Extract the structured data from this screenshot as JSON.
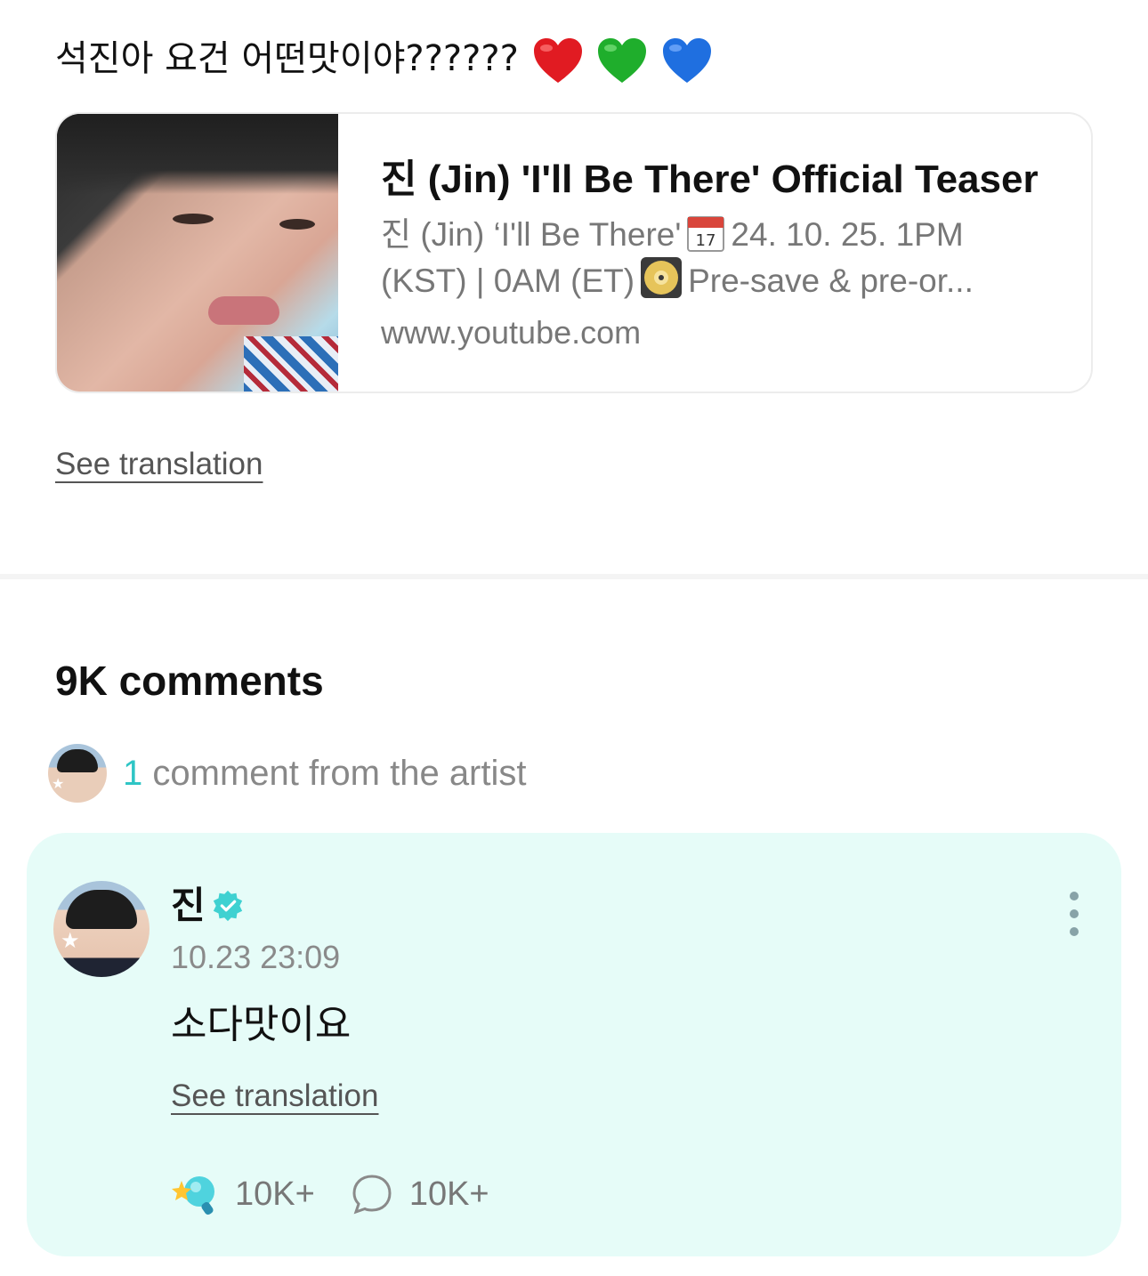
{
  "post": {
    "text": "석진아 요건 어떤맛이야??????",
    "emojis": [
      "red-heart",
      "green-heart",
      "blue-heart"
    ],
    "see_translation": "See translation"
  },
  "link_card": {
    "title": "진 (Jin) 'I'll Be There' Official Teaser",
    "description_part1": "진 (Jin) ‘I'll Be There'",
    "description_part2": "24. 10. 25. 1PM (KST) | 0AM (ET)",
    "description_part3": "Pre-save & pre-or...",
    "url": "www.youtube.com"
  },
  "comments": {
    "title": "9K comments",
    "artist_count": "1",
    "artist_label": "comment from the artist"
  },
  "comment": {
    "author": "진",
    "time": "10.23 23:09",
    "body": "소다맛이요",
    "see_translation": "See translation",
    "likes": "10K+",
    "replies": "10K+"
  },
  "colors": {
    "accent": "#2ec5c5",
    "comment_bg": "#e6fcf8",
    "verified": "#3fd1d1"
  }
}
